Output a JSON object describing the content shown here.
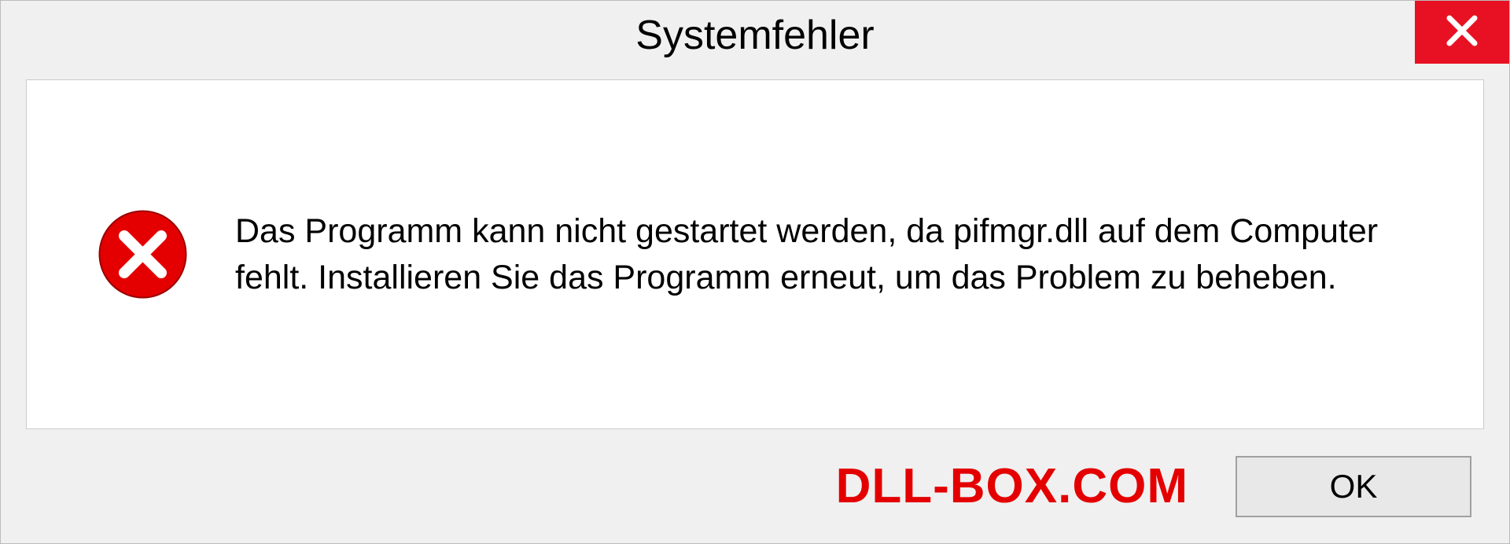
{
  "dialog": {
    "title": "Systemfehler",
    "message": "Das Programm kann nicht gestartet werden, da pifmgr.dll auf dem Computer fehlt. Installieren Sie das Programm erneut, um das Problem zu beheben.",
    "ok_label": "OK"
  },
  "watermark": "DLL-BOX.COM",
  "colors": {
    "close_button": "#e81123",
    "error_icon": "#e40000",
    "watermark": "#e40000"
  }
}
